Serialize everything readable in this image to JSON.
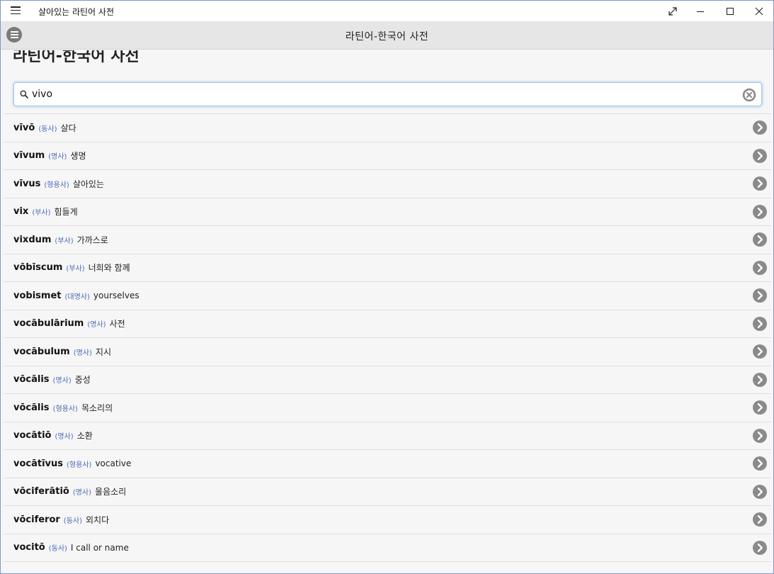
{
  "window": {
    "title": "살아있는 라틴어 사전"
  },
  "header": {
    "title": "라틴어-한국어 사전"
  },
  "page": {
    "title": "라틴어-한국어 사전"
  },
  "search": {
    "value": "vivo",
    "placeholder": ""
  },
  "icons": {
    "menu": "hamburger-icon",
    "app_menu": "circle-menu-icon",
    "search": "search-icon",
    "clear": "clear-circle-icon",
    "row_arrow": "chevron-right-circle-icon"
  },
  "colors": {
    "accent": "#4a6bb5",
    "chevron": "#8a8a8a",
    "header_bg": "#e6e6e6"
  },
  "results": [
    {
      "word": "vīvō",
      "pos": "(동사)",
      "meaning": "살다"
    },
    {
      "word": "vīvum",
      "pos": "(명사)",
      "meaning": "생명"
    },
    {
      "word": "vīvus",
      "pos": "(형용사)",
      "meaning": "살아있는"
    },
    {
      "word": "vix",
      "pos": "(부사)",
      "meaning": "힘들게"
    },
    {
      "word": "vixdum",
      "pos": "(부사)",
      "meaning": "가까스로"
    },
    {
      "word": "vōbīscum",
      "pos": "(부사)",
      "meaning": "너희와 함께"
    },
    {
      "word": "vobismet",
      "pos": "(대명사)",
      "meaning": "yourselves"
    },
    {
      "word": "vocābulārium",
      "pos": "(명사)",
      "meaning": "사전"
    },
    {
      "word": "vocābulum",
      "pos": "(명사)",
      "meaning": "지시"
    },
    {
      "word": "vōcālis",
      "pos": "(명사)",
      "meaning": "중성"
    },
    {
      "word": "vōcālis",
      "pos": "(형용사)",
      "meaning": "목소리의"
    },
    {
      "word": "vocātiō",
      "pos": "(명사)",
      "meaning": "소환"
    },
    {
      "word": "vocātīvus",
      "pos": "(형용사)",
      "meaning": " vocative"
    },
    {
      "word": "vōciferātiō",
      "pos": "(명사)",
      "meaning": "울음소리"
    },
    {
      "word": "vōciferor",
      "pos": "(동사)",
      "meaning": "외치다"
    },
    {
      "word": "vocitō",
      "pos": "(동사)",
      "meaning": "I call or name"
    }
  ]
}
